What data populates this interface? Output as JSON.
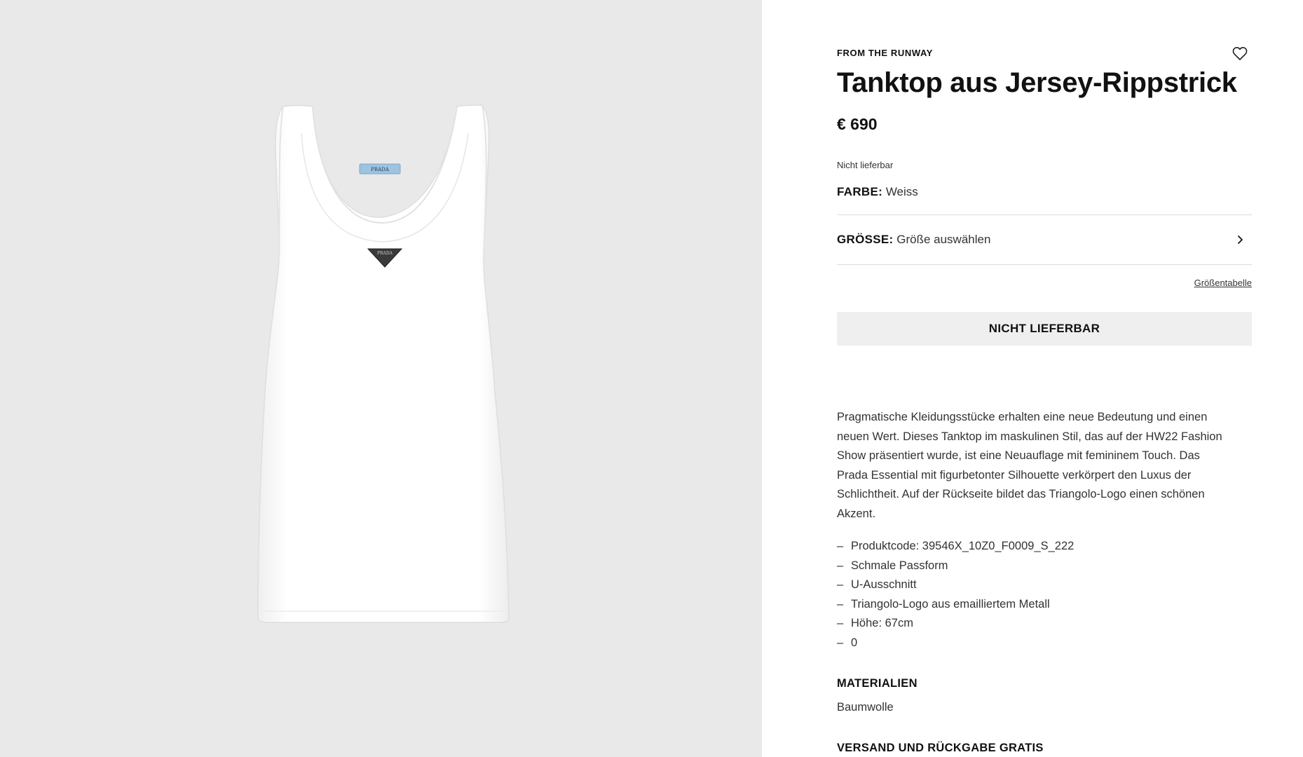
{
  "product": {
    "eyebrow": "FROM THE RUNWAY",
    "title": "Tanktop aus Jersey-Rippstrick",
    "price": "€ 690",
    "availability": "Nicht lieferbar",
    "color": {
      "label": "FARBE:",
      "value": "Weiss"
    },
    "size": {
      "label": "GRÖSSE:",
      "value": "Größe auswählen"
    },
    "size_chart_link": "Größentabelle",
    "cta_label": "NICHT LIEFERBAR",
    "description": "Pragmatische Kleidungsstücke erhalten eine neue Bedeutung und einen neuen Wert. Dieses Tanktop im maskulinen Stil, das auf der HW22 Fashion Show präsentiert wurde, ist eine Neuauflage mit femininem Touch. Das Prada Essential mit figurbetonter Silhouette verkörpert den Luxus der Schlichtheit. Auf der Rückseite bildet das Triangolo-Logo einen schönen Akzent.",
    "features": [
      "Produktcode: 39546X_10Z0_F0009_S_222",
      "Schmale Passform",
      "U-Ausschnitt",
      "Triangolo-Logo aus emailliertem Metall",
      "Höhe: 67cm",
      "0"
    ],
    "feature_bullet": "–",
    "materials": {
      "heading": "MATERIALIEN",
      "value": "Baumwolle"
    },
    "shipping_heading": "VERSAND UND RÜCKGABE GRATIS",
    "image_label_text": "PRADA"
  },
  "icons": {
    "wishlist": "heart-outline-icon",
    "size_chevron": "chevron-right-icon"
  },
  "colors": {
    "image_background": "#e9e9ea",
    "cta_background": "#efefef",
    "label_blue": "#9cc3df",
    "logo_dark": "#3a3a3a"
  }
}
